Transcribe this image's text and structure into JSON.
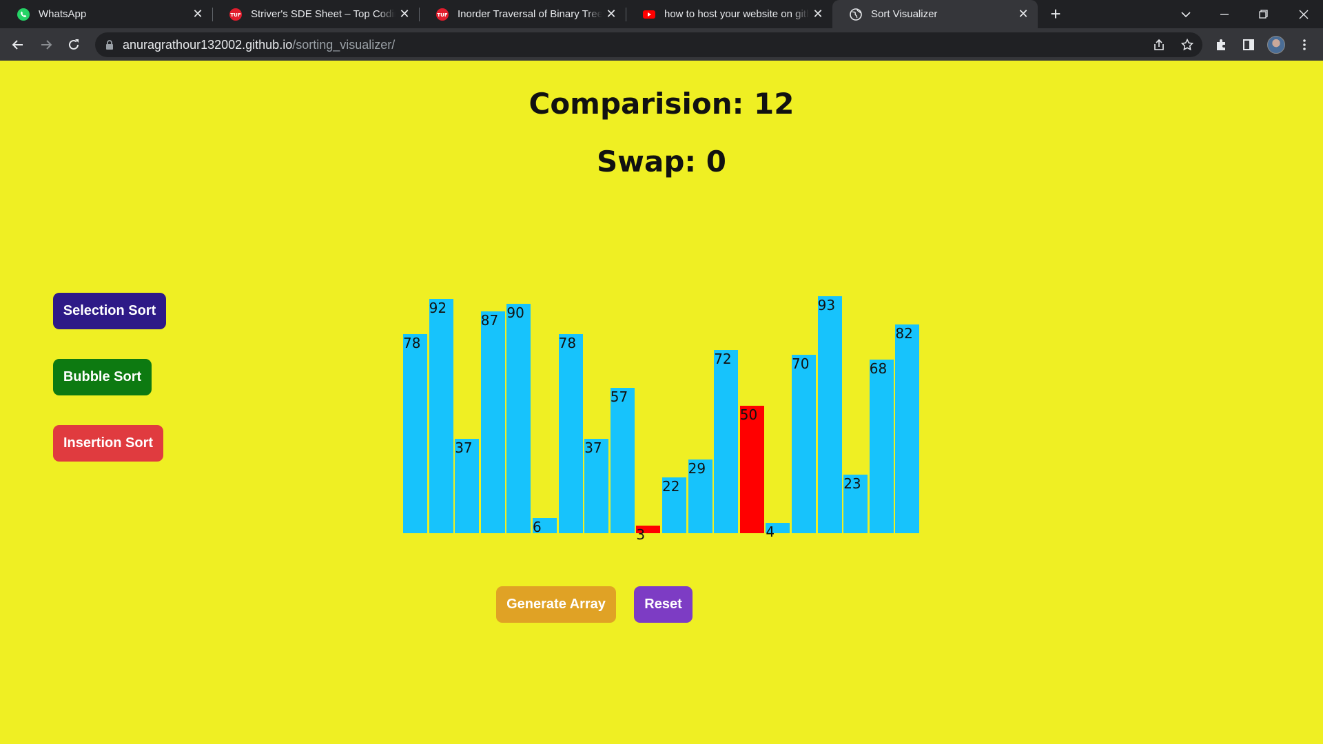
{
  "browser": {
    "tabs": [
      {
        "title": "WhatsApp",
        "icon": "whatsapp-icon",
        "active": false
      },
      {
        "title": "Striver's SDE Sheet – Top Coding",
        "icon": "tuf-icon",
        "active": false
      },
      {
        "title": "Inorder Traversal of Binary Tree -",
        "icon": "tuf-icon",
        "active": false
      },
      {
        "title": "how to host your website on gith",
        "icon": "youtube-icon",
        "active": false
      },
      {
        "title": "Sort Visualizer",
        "icon": "globe-icon",
        "active": true
      }
    ],
    "url_host": "anuragrathour132002.github.io",
    "url_path": "/sorting_visualizer/"
  },
  "stats": {
    "comparisons_label": "Comparision: 12",
    "swaps_label": "Swap: 0"
  },
  "algorithms": {
    "selection": "Selection Sort",
    "bubble": "Bubble Sort",
    "insertion": "Insertion Sort"
  },
  "controls": {
    "generate": "Generate Array",
    "reset": "Reset"
  },
  "colors": {
    "page_bg": "#efef23",
    "bar": "#17c3fc",
    "bar_highlight": "#ff0000",
    "selection_btn": "#2e1a87",
    "bubble_btn": "#0d7a11",
    "insertion_btn": "#e03b3f",
    "generate_btn": "#e0a225",
    "reset_btn": "#7d3cc4"
  },
  "array": [
    {
      "value": "78",
      "highlight": false
    },
    {
      "value": "92",
      "highlight": false
    },
    {
      "value": "37",
      "highlight": false
    },
    {
      "value": "87",
      "highlight": false
    },
    {
      "value": "90",
      "highlight": false
    },
    {
      "value": "6",
      "highlight": false
    },
    {
      "value": "78",
      "highlight": false
    },
    {
      "value": "37",
      "highlight": false
    },
    {
      "value": "57",
      "highlight": false
    },
    {
      "value": "3",
      "highlight": true
    },
    {
      "value": "22",
      "highlight": false
    },
    {
      "value": "29",
      "highlight": false
    },
    {
      "value": "72",
      "highlight": false
    },
    {
      "value": "50",
      "highlight": true
    },
    {
      "value": "4",
      "highlight": false
    },
    {
      "value": "70",
      "highlight": false
    },
    {
      "value": "93",
      "highlight": false
    },
    {
      "value": "23",
      "highlight": false
    },
    {
      "value": "68",
      "highlight": false
    },
    {
      "value": "82",
      "highlight": false
    }
  ]
}
